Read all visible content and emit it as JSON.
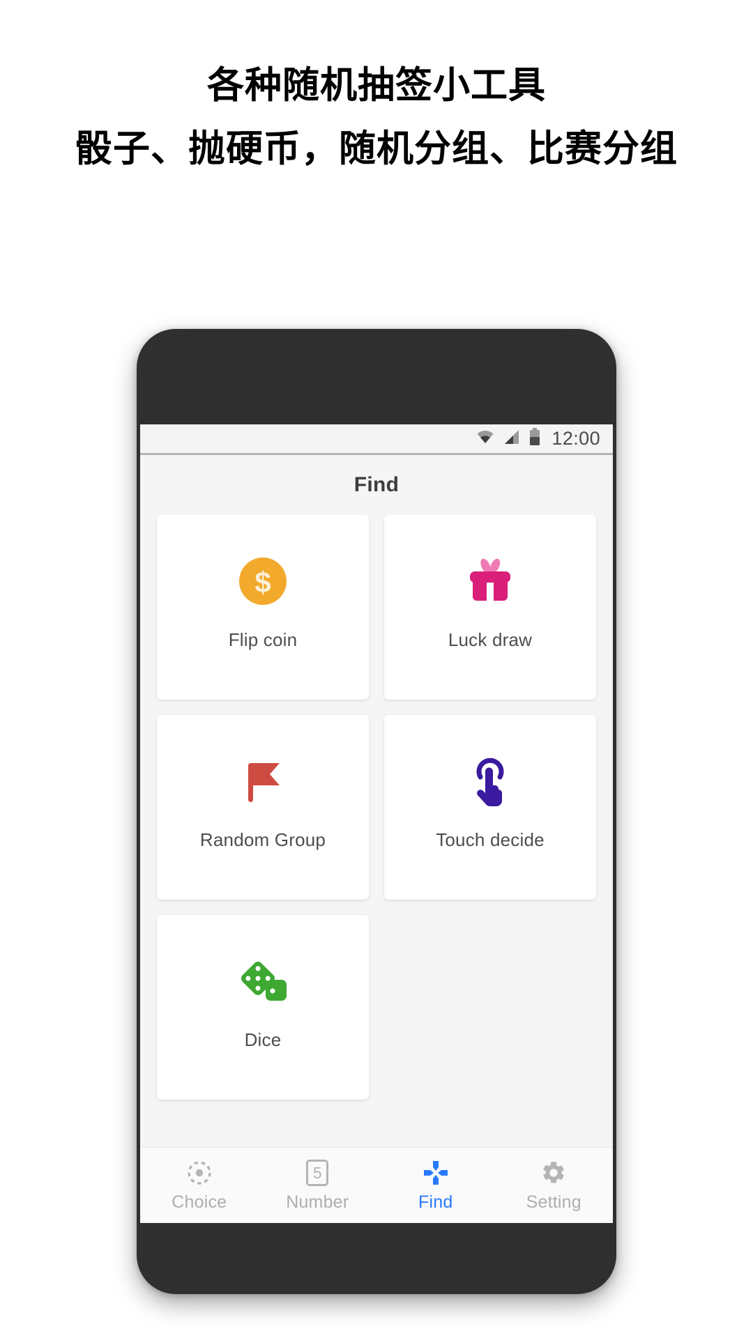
{
  "promo": {
    "title": "各种随机抽签小工具",
    "subtitle": "骰子、抛硬币，随机分组、比赛分组"
  },
  "phone": {
    "status_bar": {
      "time": "12:00",
      "icons": [
        "wifi-icon",
        "signal-icon",
        "battery-icon"
      ]
    },
    "app_bar": {
      "title": "Find"
    },
    "grid": {
      "cards": [
        {
          "label": "Flip coin",
          "icon": "coin-icon",
          "color": "#f2a92c"
        },
        {
          "label": "Luck draw",
          "icon": "gift-icon",
          "color": "#d91f7a"
        },
        {
          "label": "Random Group",
          "icon": "flag-icon",
          "color": "#ce4b42"
        },
        {
          "label": "Touch decide",
          "icon": "touch-icon",
          "color": "#3a1a9e"
        },
        {
          "label": "Dice",
          "icon": "dice-icon",
          "color": "#3ea832"
        }
      ]
    },
    "bottom_nav": {
      "active_color": "#2979ff",
      "inactive_color": "#aeaeae",
      "items": [
        {
          "label": "Choice",
          "icon": "target-icon",
          "active": false
        },
        {
          "label": "Number",
          "icon": "number-five-icon",
          "active": false,
          "badge": "5"
        },
        {
          "label": "Find",
          "icon": "explore-icon",
          "active": true
        },
        {
          "label": "Setting",
          "icon": "gear-icon",
          "active": false
        }
      ]
    }
  }
}
